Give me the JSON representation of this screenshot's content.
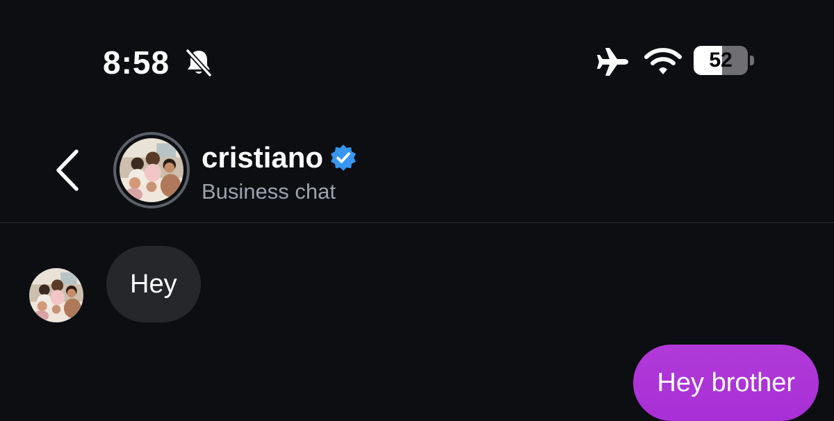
{
  "status_bar": {
    "time": "8:58",
    "battery_level": "52",
    "battery_fraction": 0.52,
    "icons": [
      "bell-off-icon",
      "airplane-icon",
      "wifi-icon",
      "battery-icon"
    ]
  },
  "header": {
    "back_icon": "chevron-left-icon",
    "contact_name": "cristiano",
    "verified": true,
    "subtitle": "Business chat"
  },
  "messages": [
    {
      "direction": "incoming",
      "text": "Hey"
    },
    {
      "direction": "outgoing",
      "text": "Hey brother"
    }
  ],
  "colors": {
    "background": "#0c0e12",
    "incoming_bubble": "#25272b",
    "outgoing_bubble": "#ab33d7",
    "verified_badge": "#3797f0",
    "subtitle_text": "#9ea2aa"
  }
}
